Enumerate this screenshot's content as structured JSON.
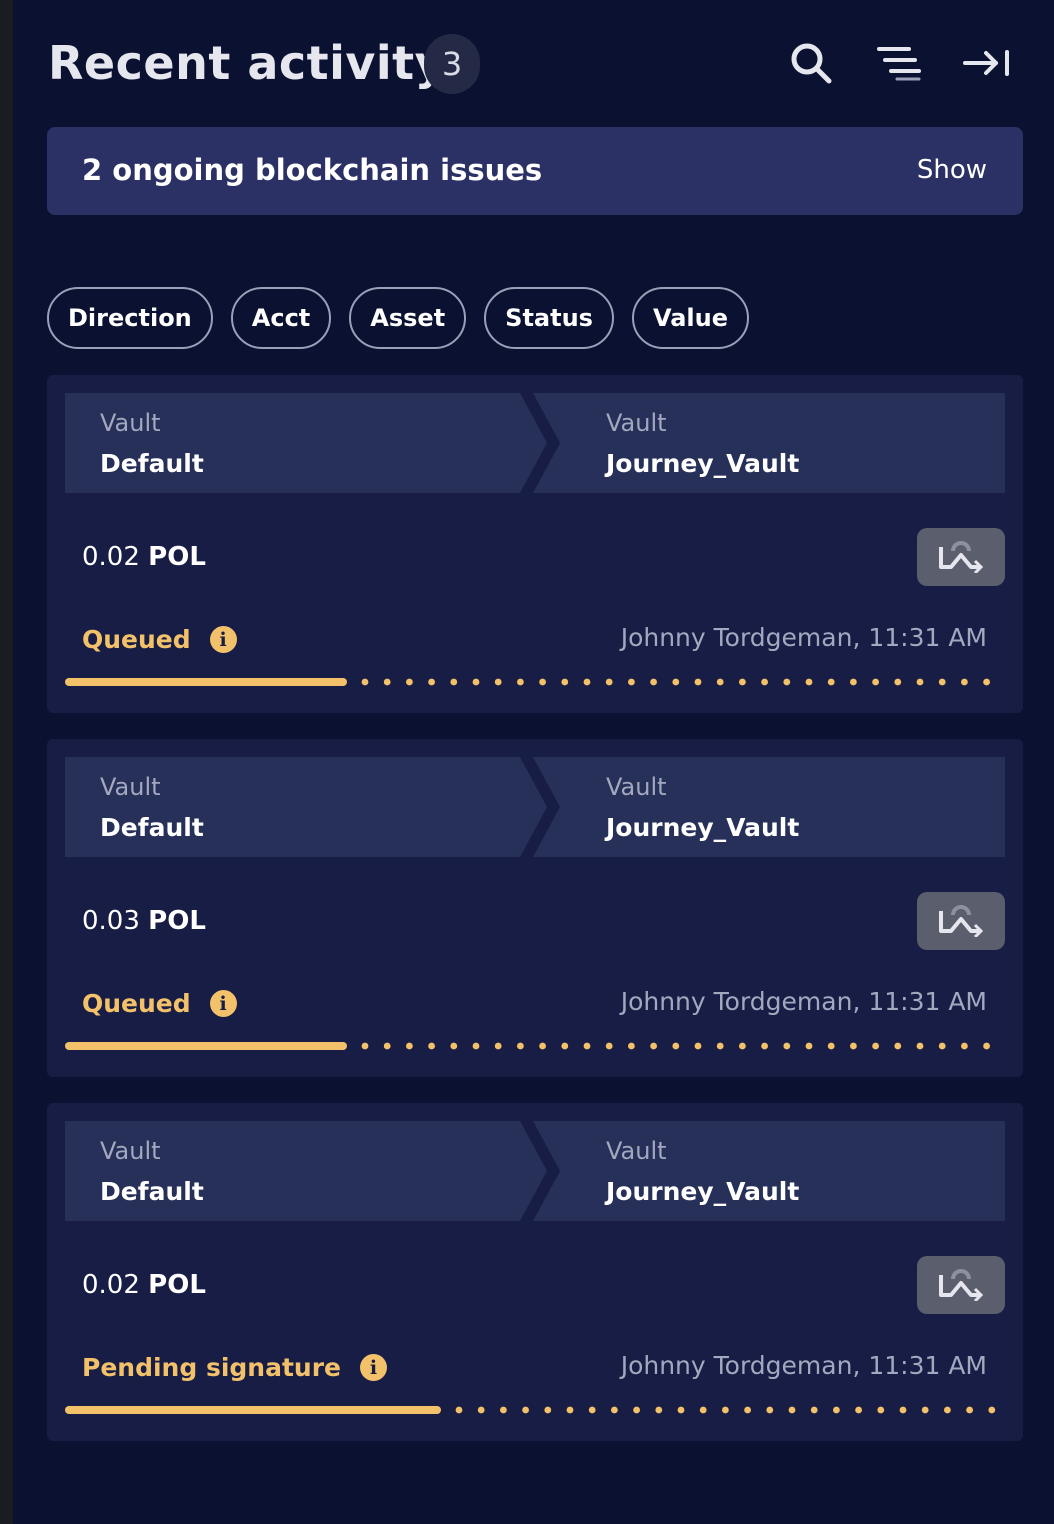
{
  "header": {
    "title": "Recent activity",
    "count": "3"
  },
  "banner": {
    "text": "2 ongoing blockchain issues",
    "action": "Show"
  },
  "filters": [
    "Direction",
    "Acct",
    "Asset",
    "Status",
    "Value"
  ],
  "transactions": [
    {
      "from_type": "Vault",
      "from_name": "Default",
      "to_type": "Vault",
      "to_name": "Journey_Vault",
      "amount": "0.02",
      "asset": "POL",
      "status": "Queued",
      "meta": "Johnny Tordgeman, 11:31 AM",
      "progress": 0.3
    },
    {
      "from_type": "Vault",
      "from_name": "Default",
      "to_type": "Vault",
      "to_name": "Journey_Vault",
      "amount": "0.03",
      "asset": "POL",
      "status": "Queued",
      "meta": "Johnny Tordgeman, 11:31 AM",
      "progress": 0.3
    },
    {
      "from_type": "Vault",
      "from_name": "Default",
      "to_type": "Vault",
      "to_name": "Journey_Vault",
      "amount": "0.02",
      "asset": "POL",
      "status": "Pending signature",
      "meta": "Johnny Tordgeman, 11:31 AM",
      "progress": 0.4
    }
  ],
  "colors": {
    "status": "#f3c16a",
    "banner": "#2b3165",
    "card": "#171d44"
  },
  "icons": [
    "search-icon",
    "filter-lines-icon",
    "collapse-panel-icon",
    "speed-up-icon",
    "info-icon"
  ]
}
